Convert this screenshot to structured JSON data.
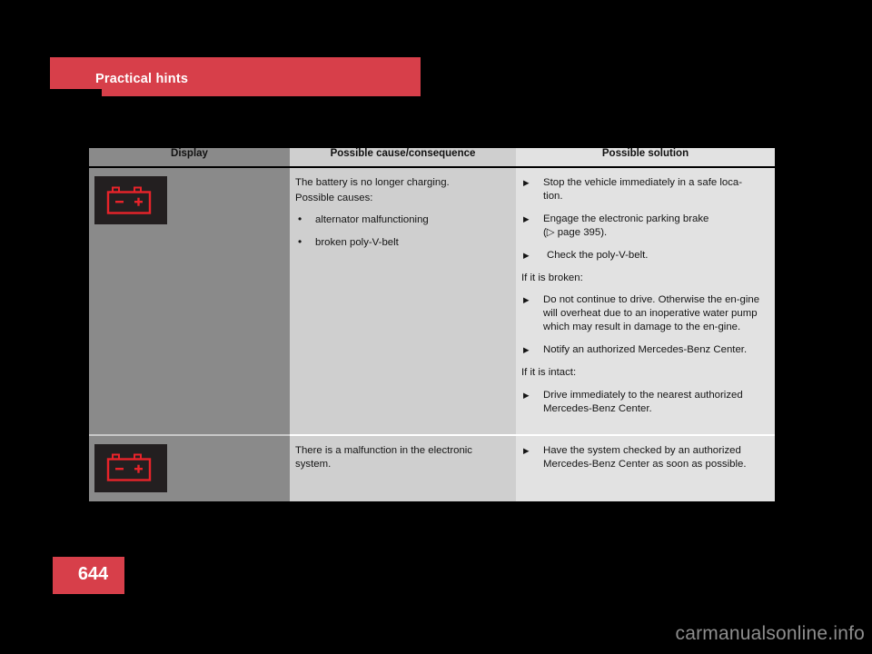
{
  "section": {
    "title": "Practical hints"
  },
  "table": {
    "headers": {
      "display": "Display",
      "cause": "Possible cause/consequence",
      "solution": "Possible solution"
    },
    "rows": [
      {
        "display_icon": "battery-warning-icon",
        "cause": {
          "lead_line_1": "The battery is no longer charging.",
          "lead_line_2": "Possible causes:",
          "bullets": [
            "alternator malfunctioning",
            "broken poly-V-belt"
          ]
        },
        "solution": {
          "items_top": [
            "Stop the vehicle immediately in a safe loca-tion.",
            "Engage the electronic parking brake\n(▷ page 395).",
            " Check the poly-V-belt."
          ],
          "item_1": "Stop the vehicle immediately in a safe loca-",
          "item_1b": "tion.",
          "item_2": "Engage the electronic parking brake",
          "item_2b": "(▷ page 395).",
          "item_3": " Check the poly-V-belt.",
          "label_broken": "If it is broken:",
          "item_4": "Do not continue to drive. Otherwise the en-gine will overheat due to an inoperative water pump which may result in damage to the en-gine.",
          "item_5": "Notify an authorized Mercedes-Benz Center.",
          "label_intact": "If it is intact:",
          "item_6": "Drive immediately to the nearest authorized Mercedes-Benz Center."
        }
      },
      {
        "display_icon": "battery-warning-icon",
        "cause": {
          "text": "There is a malfunction in the electronic system."
        },
        "solution": {
          "item_1": "Have the system checked by an authorized Mercedes-Benz Center as soon as possible."
        }
      }
    ]
  },
  "footer": {
    "page_number": "644",
    "watermark": "carmanualsonline.info"
  },
  "colors": {
    "accent_red": "#d73f4a",
    "telltale_red": "#e8232a",
    "telltale_bg": "#231f20",
    "col_display_bg": "#8a8a8a",
    "col_cause_bg": "#cfcfcf",
    "col_solution_bg": "#e2e2e2"
  }
}
